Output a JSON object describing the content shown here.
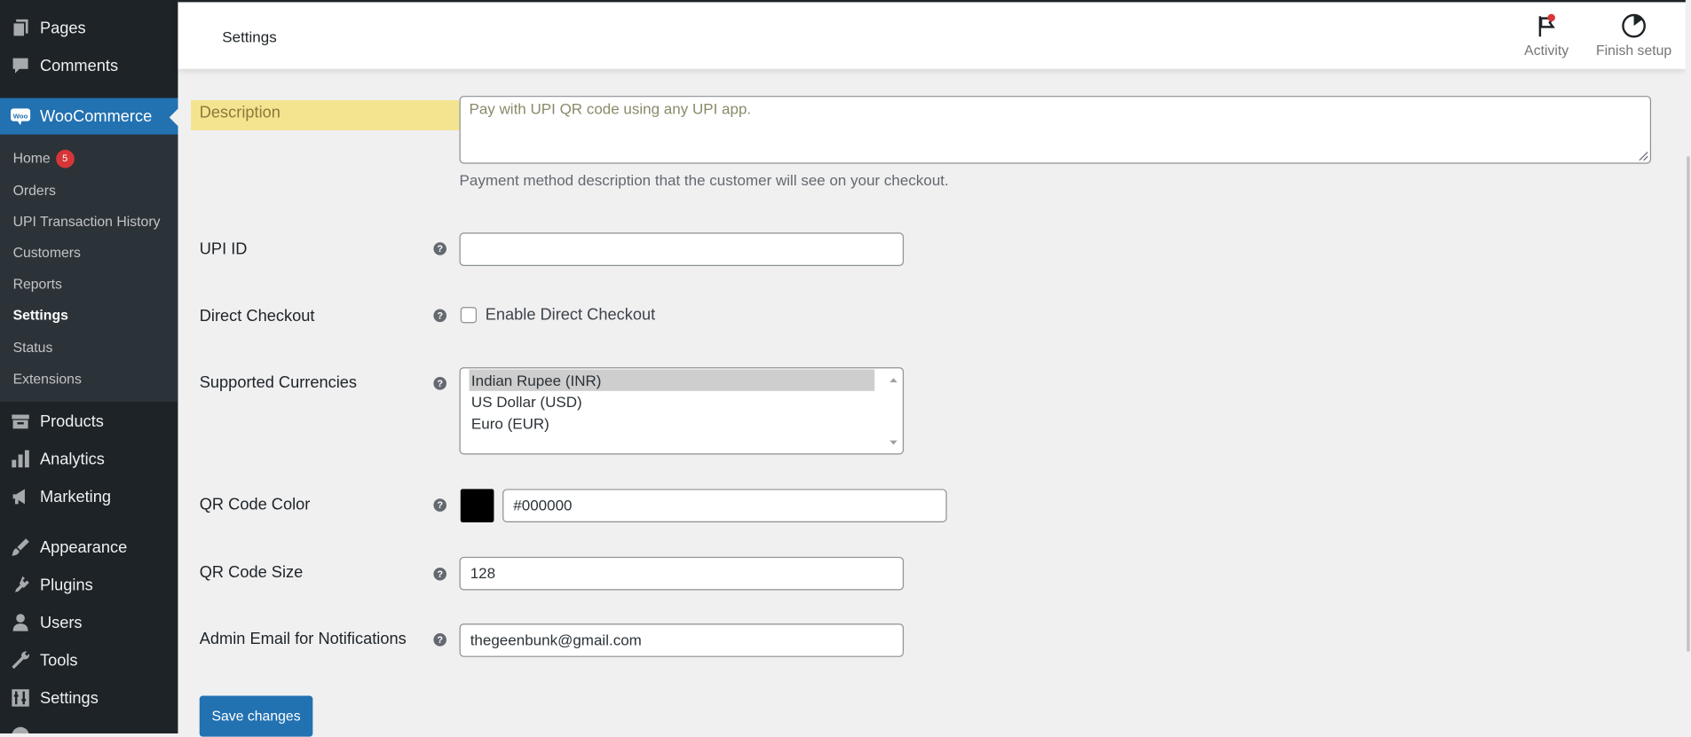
{
  "sidebar": {
    "top_items": [
      {
        "label": "Pages",
        "icon": "pages-icon"
      },
      {
        "label": "Comments",
        "icon": "comments-icon"
      }
    ],
    "woocommerce": {
      "label": "WooCommerce",
      "icon": "woo-logo-icon",
      "logo_text": "Woo"
    },
    "submenu": [
      {
        "label": "Home",
        "badge": "5"
      },
      {
        "label": "Orders"
      },
      {
        "label": "UPI Transaction History"
      },
      {
        "label": "Customers"
      },
      {
        "label": "Reports"
      },
      {
        "label": "Settings",
        "current": true
      },
      {
        "label": "Status"
      },
      {
        "label": "Extensions"
      }
    ],
    "bottom_items": [
      {
        "label": "Products",
        "icon": "products-icon"
      },
      {
        "label": "Analytics",
        "icon": "analytics-icon"
      },
      {
        "label": "Marketing",
        "icon": "marketing-icon"
      },
      {
        "label": "Appearance",
        "icon": "appearance-icon"
      },
      {
        "label": "Plugins",
        "icon": "plugins-icon"
      },
      {
        "label": "Users",
        "icon": "users-icon"
      },
      {
        "label": "Tools",
        "icon": "tools-icon"
      },
      {
        "label": "Settings",
        "icon": "settings-icon"
      }
    ]
  },
  "topbar": {
    "title": "Settings",
    "activity_label": "Activity",
    "finish_setup_label": "Finish setup"
  },
  "form": {
    "description": {
      "label": "Description",
      "value": "Pay with UPI QR code using any UPI app.",
      "help_text": "Payment method description that the customer will see on your checkout."
    },
    "upi_id": {
      "label": "UPI ID",
      "value": ""
    },
    "direct_checkout": {
      "label": "Direct Checkout",
      "checkbox_label": "Enable Direct Checkout",
      "checked": false
    },
    "supported_currencies": {
      "label": "Supported Currencies",
      "options": [
        "Indian Rupee (INR)",
        "US Dollar (USD)",
        "Euro (EUR)"
      ],
      "selected": "Indian Rupee (INR)"
    },
    "qr_code_color": {
      "label": "QR Code Color",
      "value": "#000000",
      "swatch_color": "#000000"
    },
    "qr_code_size": {
      "label": "QR Code Size",
      "value": "128"
    },
    "admin_email": {
      "label": "Admin Email for Notifications",
      "value": "thegeenbunk@gmail.com"
    },
    "help_glyph": "?",
    "save_label": "Save changes"
  },
  "colors": {
    "sidebar_bg": "#1d2327",
    "submenu_bg": "#2c3338",
    "accent": "#2271b1",
    "badge": "#d63638",
    "highlight": "#f7dc50"
  }
}
